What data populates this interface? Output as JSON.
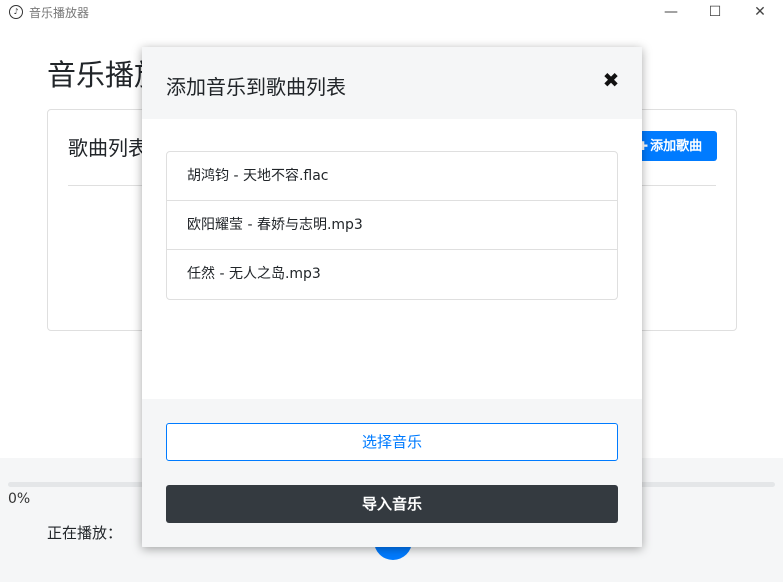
{
  "window": {
    "title": "音乐播放器",
    "minimize_icon": "—",
    "maximize_icon": "☐",
    "close_icon": "✕"
  },
  "page": {
    "title": "音乐播放器"
  },
  "playlist_card": {
    "title": "歌曲列表",
    "add_button_label": "添加歌曲",
    "add_button_icon": "plus-icon"
  },
  "player": {
    "progress_percent": 0,
    "progress_text": "0%",
    "now_playing_label": "正在播放："
  },
  "modal": {
    "title": "添加音乐到歌曲列表",
    "close_icon": "✖",
    "files": [
      "胡鸿钧 - 天地不容.flac",
      "欧阳耀莹 - 春娇与志明.mp3",
      "任然 - 无人之岛.mp3"
    ],
    "choose_button_label": "选择音乐",
    "import_button_label": "导入音乐"
  },
  "colors": {
    "primary": "#007bff",
    "dark": "#343a40",
    "muted_bg": "#f5f6f7"
  }
}
